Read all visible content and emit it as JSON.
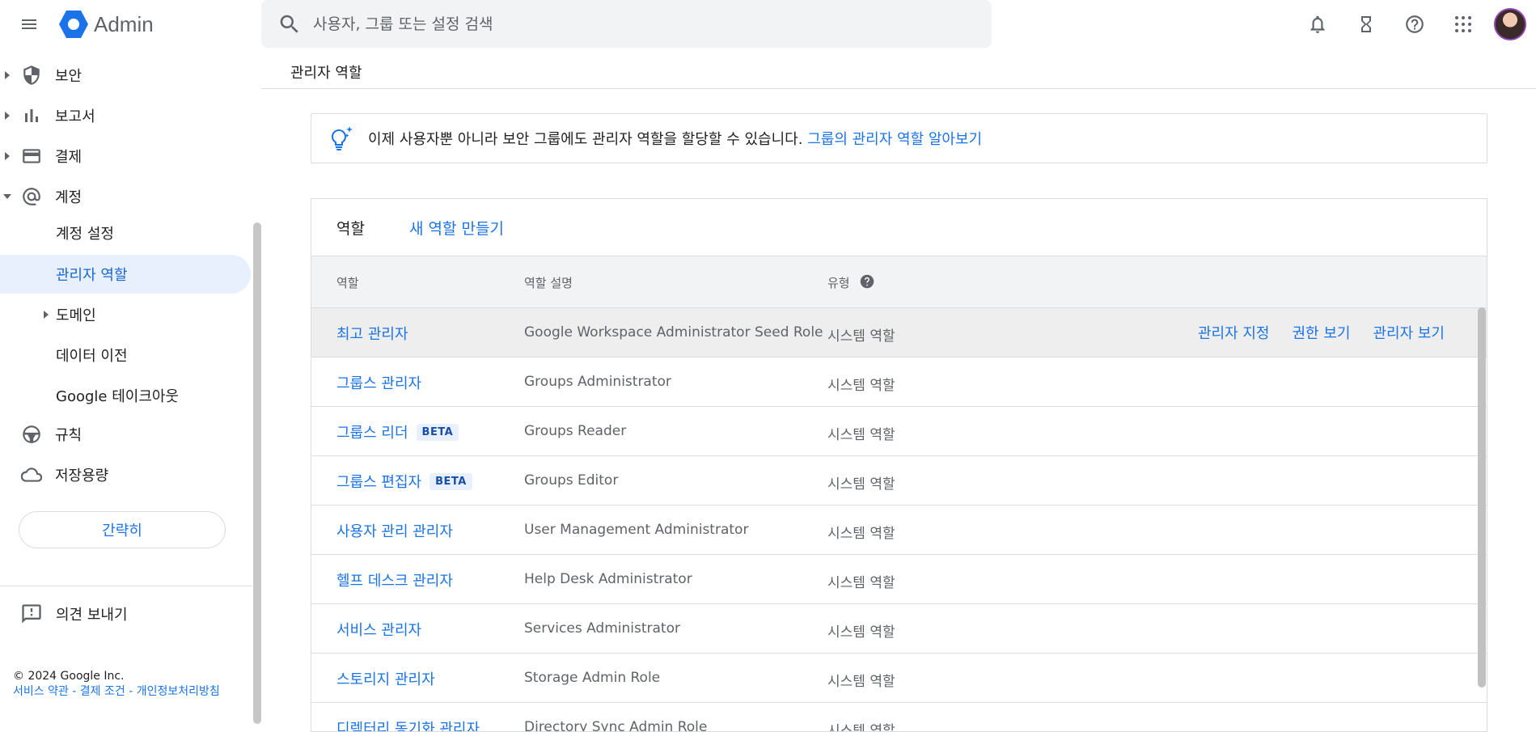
{
  "header": {
    "app_name": "Admin",
    "search_placeholder": "사용자, 그룹 또는 설정 검색"
  },
  "sidebar": {
    "items": [
      {
        "label": "보안",
        "icon": "shield-icon"
      },
      {
        "label": "보고서",
        "icon": "bar-chart-icon"
      },
      {
        "label": "결제",
        "icon": "credit-card-icon"
      },
      {
        "label": "계정",
        "icon": "at-sign-icon"
      }
    ],
    "sub_items": [
      {
        "label": "계정 설정"
      },
      {
        "label": "관리자 역할"
      },
      {
        "label": "도메인"
      },
      {
        "label": "데이터 이전"
      },
      {
        "label": "Google 테이크아웃"
      }
    ],
    "items2": [
      {
        "label": "규칙",
        "icon": "steering-wheel-icon"
      },
      {
        "label": "저장용량",
        "icon": "cloud-icon"
      }
    ],
    "collapse_label": "간략히",
    "feedback_label": "의견 보내기",
    "footer_copyright": "© 2024 Google Inc.",
    "footer_links": "서비스 약관 - 결제 조건 - 개인정보처리방침"
  },
  "main": {
    "page_title": "관리자 역할",
    "banner_text": "이제 사용자뿐 아니라 보안 그룹에도 관리자 역할을 할당할 수 있습니다.",
    "banner_link": "그룹의 관리자 역할 알아보기",
    "card_title": "역할",
    "new_role_label": "새 역할 만들기",
    "columns": {
      "role": "역할",
      "desc": "역할 설명",
      "type": "유형"
    },
    "row_actions": [
      "관리자 지정",
      "권한 보기",
      "관리자 보기"
    ],
    "rows": [
      {
        "role": "최고 관리자",
        "desc": "Google Workspace Administrator Seed Role",
        "type": "시스템 역할",
        "beta": ""
      },
      {
        "role": "그룹스 관리자",
        "desc": "Groups Administrator",
        "type": "시스템 역할",
        "beta": ""
      },
      {
        "role": "그룹스 리더",
        "desc": "Groups Reader",
        "type": "시스템 역할",
        "beta": "BETA"
      },
      {
        "role": "그룹스 편집자",
        "desc": "Groups Editor",
        "type": "시스템 역할",
        "beta": "BETA"
      },
      {
        "role": "사용자 관리 관리자",
        "desc": "User Management Administrator",
        "type": "시스템 역할",
        "beta": ""
      },
      {
        "role": "헬프 데스크 관리자",
        "desc": "Help Desk Administrator",
        "type": "시스템 역할",
        "beta": ""
      },
      {
        "role": "서비스 관리자",
        "desc": "Services Administrator",
        "type": "시스템 역할",
        "beta": ""
      },
      {
        "role": "스토리지 관리자",
        "desc": "Storage Admin Role",
        "type": "시스템 역할",
        "beta": ""
      },
      {
        "role": "디렉터리 동기화 관리자",
        "desc": "Directory Sync Admin Role",
        "type": "시스템 역할",
        "beta": ""
      }
    ]
  }
}
